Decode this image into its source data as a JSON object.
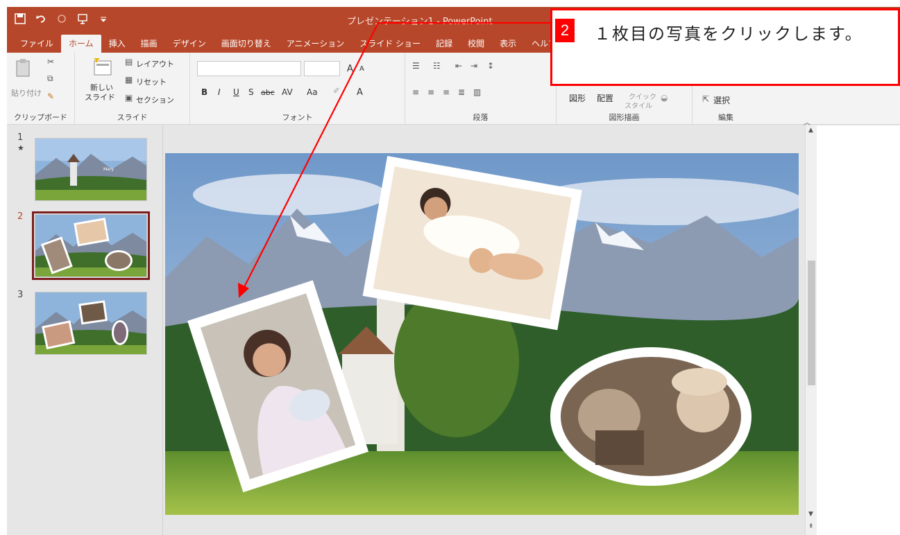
{
  "app": {
    "title": "プレゼンテーション1 - PowerPoint"
  },
  "tabs": [
    "ファイル",
    "ホーム",
    "挿入",
    "描画",
    "デザイン",
    "画面切り替え",
    "アニメーション",
    "スライド ショー",
    "記録",
    "校閲",
    "表示",
    "ヘルプ"
  ],
  "ribbon": {
    "clipboard": {
      "paste": "貼り付け",
      "label": "クリップボード"
    },
    "slides": {
      "new_slide_1": "新しい",
      "new_slide_2": "スライド",
      "layout": "レイアウト",
      "reset": "リセット",
      "section": "セクション",
      "label": "スライド"
    },
    "font": {
      "label": "フォント",
      "bold": "B",
      "italic": "I",
      "underline": "U",
      "shadow": "S",
      "strike": "abc",
      "spacing": "AV",
      "case": "Aa",
      "grow": "A",
      "shrink": "A"
    },
    "paragraph": {
      "label": "段落"
    },
    "drawing": {
      "shape": "図形",
      "arrange": "配置",
      "quick1": "クイック",
      "quick2": "スタイル",
      "label": "図形描画"
    },
    "editing": {
      "select": "選択",
      "label": "編集"
    }
  },
  "thumbnails": [
    {
      "num": "1",
      "star": "★",
      "caption": "Mary"
    },
    {
      "num": "2"
    },
    {
      "num": "3"
    }
  ],
  "callout": {
    "step": "2",
    "text": "１枚目の写真をクリックします。"
  },
  "colors": {
    "accent": "#b7472a",
    "callout": "#ff0000",
    "selected_thumb": "#7a1e1e"
  }
}
